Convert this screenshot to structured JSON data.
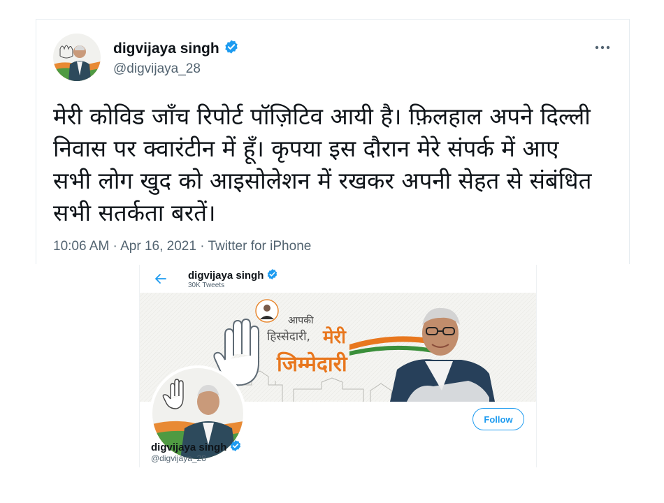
{
  "tweet": {
    "author_name": "digvijaya singh",
    "author_handle": "@digvijaya_28",
    "more_icon": "more-horizontal-icon",
    "text": "मेरी कोविड जाँच रिपोर्ट पॉज़िटिव आयी है। फ़िलहाल अपने दिल्ली\nनिवास पर क्वारंटीन में हूँ। कृपया इस दौरान मेरे संपर्क में आए\nसभी लोग खुद को आइसोलेशन में रखकर अपनी सेहत से संबंधित\nसभी सतर्कता बरतें।",
    "time": "10:06 AM",
    "separator": " · ",
    "date": "Apr 16, 2021",
    "source": "Twitter for iPhone"
  },
  "profile": {
    "back_icon": "arrow-left-icon",
    "header_name": "digvijaya singh",
    "tweet_count": "30K Tweets",
    "banner": {
      "line1": "आपकी",
      "line2": "हिस्सेदारी,",
      "line3": "मेरी",
      "line4": "जिम्मेदारी"
    },
    "follow_label": "Follow",
    "name": "digvijaya singh",
    "handle": "@digvijaya_28"
  },
  "colors": {
    "verified": "#1d9bf0",
    "accent": "#1d9bf0",
    "secondary_text": "#536471",
    "banner_orange": "#e8771e",
    "banner_green": "#3a8f3a"
  }
}
